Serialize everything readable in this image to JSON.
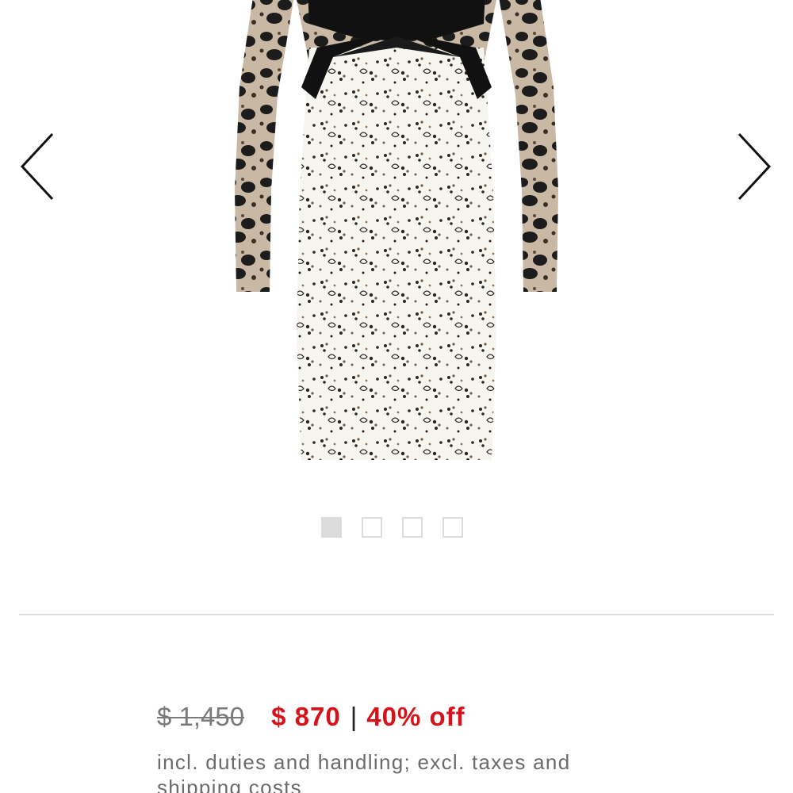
{
  "gallery": {
    "image_alt": "",
    "prev_icon": "chevron-left-icon",
    "next_icon": "chevron-right-icon",
    "dots_total": 4,
    "active_dot": 1
  },
  "price": {
    "original": "$ 1,450",
    "sale": "$ 870",
    "separator": "|",
    "discount": "40% off"
  },
  "note": "incl. duties and handling; excl. taxes and shipping costs",
  "colors": {
    "sale": "#d6121b",
    "divider": "#dedede",
    "dot": "#dcdcdc",
    "muted_text": "#6b6b6b"
  }
}
